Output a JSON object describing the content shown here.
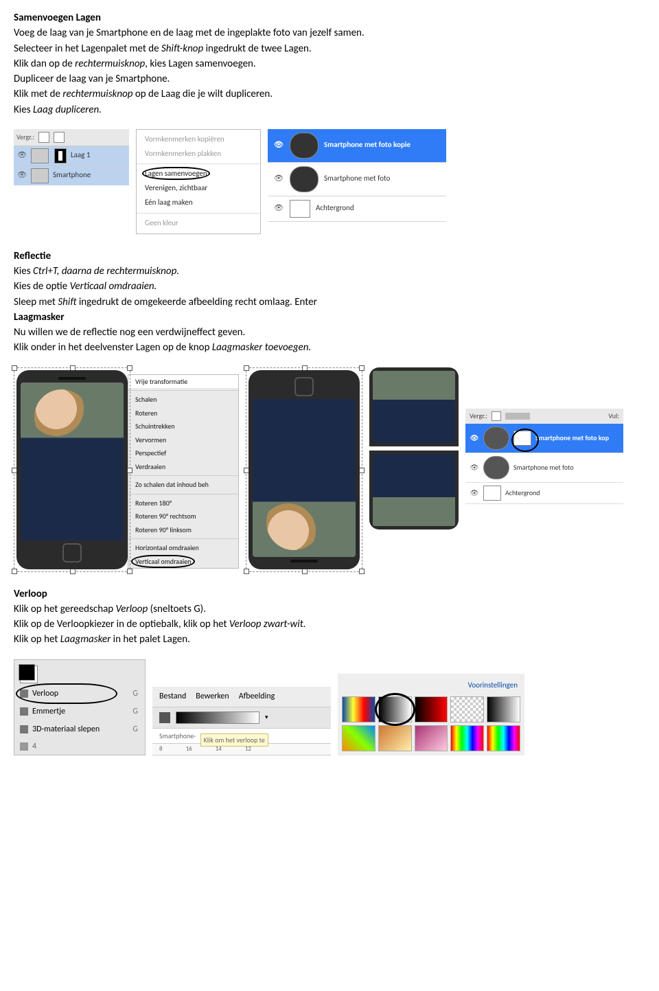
{
  "sect1": {
    "title": "Samenvoegen Lagen",
    "l1a": "Voeg de laag van je Smartphone en de laag met de ingeplakte foto van jezelf samen.",
    "l2a": "Selecteer in het Lagenpalet met de ",
    "l2b": "Shift-knop",
    "l2c": " ingedrukt de twee Lagen.",
    "l3a": "Klik dan op de ",
    "l3b": "rechtermuisknop",
    "l3c": ", kies Lagen samenvoegen.",
    "l4": "Dupliceer de laag van je Smartphone.",
    "l5a": "Klik met de ",
    "l5b": "rechtermuisknop",
    "l5c": " op de Laag die je wilt dupliceren.",
    "l6a": "Kies ",
    "l6b": "Laag dupliceren."
  },
  "layers1": {
    "vergr": "Vergr.:",
    "row1": "Laag 1",
    "row2": "Smartphone"
  },
  "ctx1": {
    "i1": "Vormkenmerken kopiëren",
    "i2": "Vormkenmerken plakken",
    "i3": "Lagen samenvoegen",
    "i4": "Verenigen, zichtbaar",
    "i5": "Eén laag maken",
    "i6": "Geen kleur"
  },
  "layers2": {
    "r1": "Smartphone met foto kopie",
    "r2": "Smartphone met foto",
    "r3": "Achtergrond"
  },
  "sect2": {
    "title": "Reflectie",
    "l1a": "Kies ",
    "l1b": "Ctrl+T, daarna de rechtermuisknop.",
    "l2a": "Kies de optie ",
    "l2b": "Verticaal omdraaien.",
    "l3a": "Sleep met ",
    "l3b": "Shift",
    "l3c": " ingedrukt de omgekeerde afbeelding recht omlaag. Enter",
    "sub": "Laagmasker",
    "l4": "Nu willen we de reflectie nog een verdwijneffect geven.",
    "l5a": "Klik onder in het deelvenster Lagen op de knop ",
    "l5b": "Laagmasker toevoegen."
  },
  "ctx2": {
    "head": "Vrije transformatie",
    "i1": "Schalen",
    "i2": "Roteren",
    "i3": "Schuintrekken",
    "i4": "Vervormen",
    "i5": "Perspectief",
    "i6": "Verdraaien",
    "i7": "Zo schalen dat inhoud beh",
    "i8": "Roteren 180°",
    "i9": "Roteren 90° rechtsom",
    "i10": "Roteren 90° linksom",
    "i11": "Horizontaal omdraaien",
    "i12": "Verticaal omdraaien"
  },
  "layers3": {
    "top1": "Vergr.:",
    "top2": "Vul:",
    "r1": "Smartphone met foto kop",
    "r2": "Smartphone met foto",
    "r3": "Achtergrond"
  },
  "sect3": {
    "title": "Verloop",
    "l1a": "Klik op het gereedschap ",
    "l1b": "Verloop",
    "l1c": " (sneltoets G).",
    "l2a": "Klik op de Verloopkiezer in de optiebalk, klik op het ",
    "l2b": "Verloop zwart-wit.",
    "l3a": "Klik op het ",
    "l3b": "Laagmasker",
    "l3c": " in het palet Lagen."
  },
  "tools": {
    "t1": "Verloop",
    "t2": "Emmertje",
    "t3": "3D-materiaal slepen",
    "sc": "G",
    "below": "4"
  },
  "menu": {
    "m1": "Bestand",
    "m2": "Bewerken",
    "m3": "Afbeelding",
    "tab": "Smartphone-",
    "tip": "Klik om het verloop te",
    "r1": "8",
    "r2": "16",
    "r3": "14",
    "r4": "12"
  },
  "swatches": {
    "title": "Voorinstellingen"
  }
}
